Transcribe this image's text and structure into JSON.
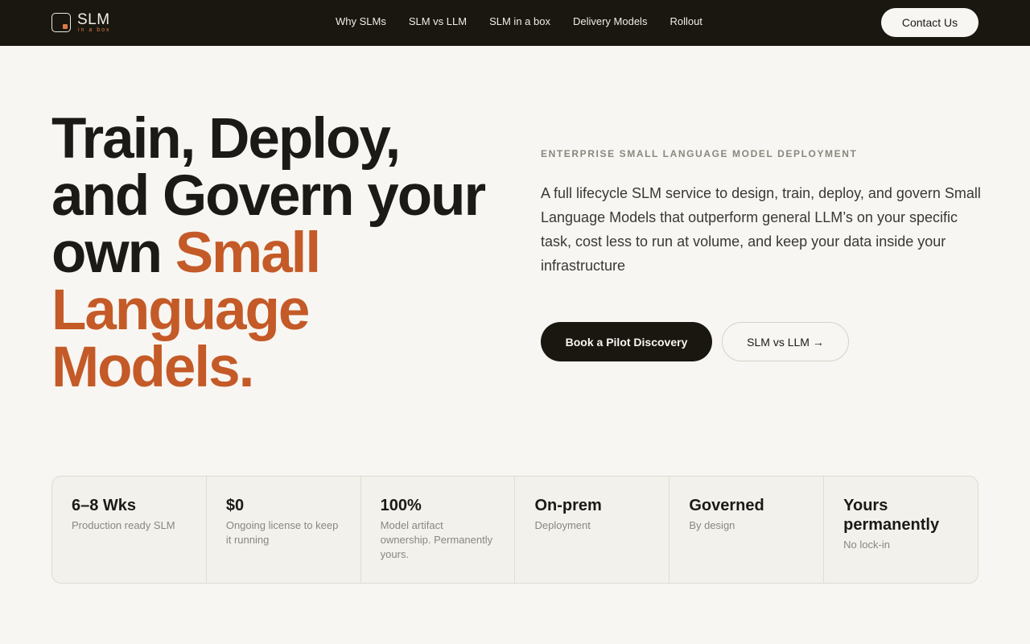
{
  "header": {
    "logo_text": "SLM",
    "logo_sub": "in a box",
    "nav": [
      "Why SLMs",
      "SLM vs LLM",
      "SLM in a box",
      "Delivery Models",
      "Rollout"
    ],
    "contact_label": "Contact Us"
  },
  "hero": {
    "headline_dark": "Train, Deploy, and Govern your own ",
    "headline_accent": "Small Language Models.",
    "eyebrow": "ENTERPRISE SMALL LANGUAGE MODEL DEPLOYMENT",
    "lead": "A full lifecycle SLM service to design, train, deploy, and govern Small Language Models that outperform general LLM’s on your specific task, cost less to run at volume, and keep your data inside your infrastructure",
    "primary_cta": "Book a Pilot Discovery",
    "secondary_cta": "SLM vs LLM →"
  },
  "stats": [
    {
      "value": "6–8 Wks",
      "label": "Production ready SLM"
    },
    {
      "value": "$0",
      "label": "Ongoing license to keep it running"
    },
    {
      "value": "100%",
      "label": "Model artifact ownership. Permanently yours."
    },
    {
      "value": "On-prem",
      "label": "Deployment"
    },
    {
      "value": "Governed",
      "label": "By design"
    },
    {
      "value": "Yours permanently",
      "label": "No lock-in"
    }
  ],
  "colors": {
    "accent": "#c45a27",
    "topbar": "#19170f",
    "background": "#f8f6f2"
  }
}
